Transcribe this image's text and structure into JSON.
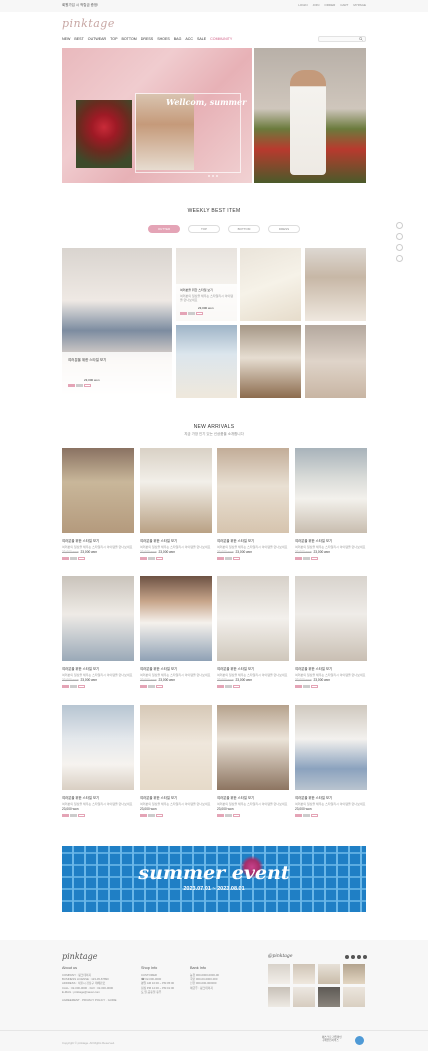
{
  "topbar": {
    "message": "회원가입 시 적립금 증정!",
    "links": [
      "LOGIN",
      "JOIN",
      "ORDER",
      "CART",
      "MYPAGE"
    ]
  },
  "brand": {
    "logo": "pinktage"
  },
  "nav": {
    "items": [
      "NEW",
      "BEST",
      "OUTWEAR",
      "TOP",
      "BOTTOM",
      "DRESS",
      "SHOES",
      "BAG",
      "ACC",
      "SALE",
      "COMMUNITY"
    ],
    "highlight_index": 10
  },
  "search": {
    "placeholder": ""
  },
  "hero": {
    "title": "Wellcom, summer"
  },
  "weekly_best": {
    "title": "WEEKLY BEST ITEM",
    "tabs": [
      "OUTTER",
      "TOP",
      "BOTTOM",
      "DRESS"
    ],
    "active_tab": 0,
    "featured": {
      "name": "여러분을 위한 스타일 보기",
      "price": "23,000 won"
    },
    "items": [
      {
        "name": "여러분을 위한 스타일 보기",
        "desc": "여러분의 일상을 채우는 스타일리시 아이템을 만나보세요",
        "price": "23,000 won"
      },
      {
        "name": "",
        "desc": "",
        "price": ""
      },
      {
        "name": "",
        "desc": "",
        "price": ""
      },
      {
        "name": "",
        "desc": "",
        "price": ""
      },
      {
        "name": "",
        "desc": "",
        "price": ""
      },
      {
        "name": "",
        "desc": "",
        "price": ""
      }
    ]
  },
  "new_arrivals": {
    "title": "NEW ARRIVALS",
    "subtitle": "지금 가장 인기 있는 신상품을 소개합니다",
    "products": [
      {
        "name": "여러분을 위한 스타일 보기",
        "desc": "여러분의 일상을 채우는 스타일리시 아이템을 만나보세요",
        "old_price": "33,000 won",
        "price": "23,000 won"
      },
      {
        "name": "여러분을 위한 스타일 보기",
        "desc": "여러분의 일상을 채우는 스타일리시 아이템을 만나보세요",
        "old_price": "33,000 won",
        "price": "23,000 won"
      },
      {
        "name": "여러분을 위한 스타일 보기",
        "desc": "여러분의 일상을 채우는 스타일리시 아이템을 만나보세요",
        "old_price": "33,000 won",
        "price": "23,000 won"
      },
      {
        "name": "여러분을 위한 스타일 보기",
        "desc": "여러분의 일상을 채우는 스타일리시 아이템을 만나보세요",
        "old_price": "33,000 won",
        "price": "23,000 won"
      },
      {
        "name": "여러분을 위한 스타일 보기",
        "desc": "여러분의 일상을 채우는 스타일리시 아이템을 만나보세요",
        "old_price": "33,000 won",
        "price": "23,000 won"
      },
      {
        "name": "여러분을 위한 스타일 보기",
        "desc": "여러분의 일상을 채우는 스타일리시 아이템을 만나보세요",
        "old_price": "33,000 won",
        "price": "23,000 won"
      },
      {
        "name": "여러분을 위한 스타일 보기",
        "desc": "여러분의 일상을 채우는 스타일리시 아이템을 만나보세요",
        "old_price": "33,000 won",
        "price": "23,000 won"
      },
      {
        "name": "여러분을 위한 스타일 보기",
        "desc": "여러분의 일상을 채우는 스타일리시 아이템을 만나보세요",
        "old_price": "33,000 won",
        "price": "23,000 won"
      },
      {
        "name": "여러분을 위한 스타일 보기",
        "desc": "여러분의 일상을 채우는 스타일리시 아이템을 만나보세요",
        "old_price": "",
        "price": "23,000 won"
      },
      {
        "name": "여러분을 위한 스타일 보기",
        "desc": "여러분의 일상을 채우는 스타일리시 아이템을 만나보세요",
        "old_price": "",
        "price": "23,000 won"
      },
      {
        "name": "여러분을 위한 스타일 보기",
        "desc": "여러분의 일상을 채우는 스타일리시 아이템을 만나보세요",
        "old_price": "",
        "price": "23,000 won"
      },
      {
        "name": "여러분을 위한 스타일 보기",
        "desc": "여러분의 일상을 채우는 스타일리시 아이템을 만나보세요",
        "old_price": "",
        "price": "23,000 won"
      }
    ]
  },
  "banner": {
    "title": "summer event",
    "dates": "2023.07.01 ~ 2023.08.01"
  },
  "footer": {
    "logo": "pinktage",
    "about": {
      "heading": "About us",
      "lines": [
        "COMPANY : 핑크테이지",
        "BUSINESS LICENSE : 123-45-67890",
        "ADDRESS : 서울시 강남구 테헤란로",
        "CALL : 02-000-0000 · FAX : 02-000-0000",
        "E-MAIL : pinktage@naver.com"
      ]
    },
    "shop": {
      "heading": "Shop Info",
      "lines": [
        "CUSTOMER",
        "☎ 02-000-0000",
        "평일 AM 10:00 ~ PM 05:00",
        "점심 PM 12:00 ~ PM 01:00",
        "토,일,공휴일 휴무"
      ]
    },
    "bank": {
      "heading": "Bank Info",
      "lines": [
        "농협 000-0000-0000-00",
        "국민 000-00-0000-000",
        "신한 000-000-000000",
        "예금주 : 핑크테이지"
      ]
    },
    "insta_logo": "@pinktage",
    "links": [
      "AGREEMENT",
      "PRIVACY POLICY",
      "GUIDE"
    ],
    "copyright": "Copyright © pinktage. All Rights Reserved.",
    "badge": [
      "에스크로 가입확인",
      "구매안전서비스"
    ]
  },
  "colors": {
    "accent": "#e4a4b6",
    "highlight": "#d05f86",
    "banner_blue": "#1f7fc5"
  }
}
